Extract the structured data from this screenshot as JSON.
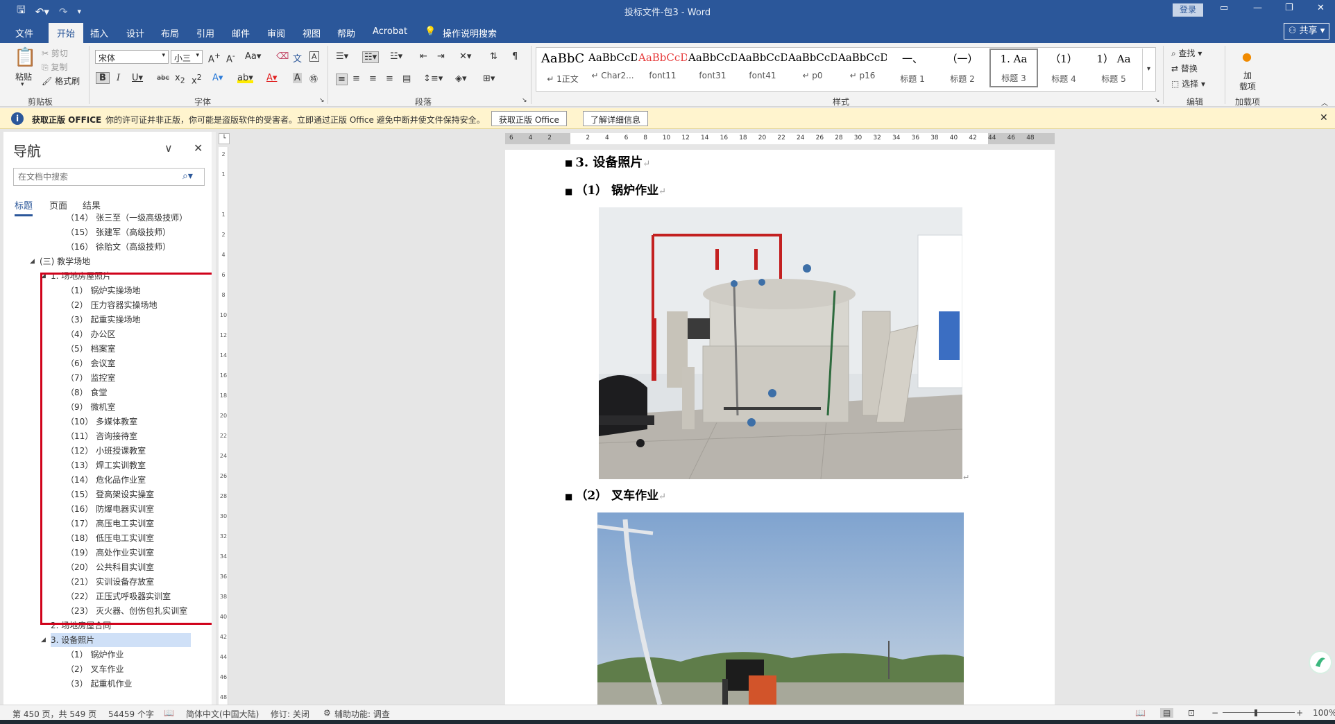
{
  "titlebar": {
    "doc_title": "投标文件-包3 - Word",
    "login": "登录",
    "qat": {
      "save_icon": "save-icon",
      "undo_icon": "undo-icon",
      "redo_icon": "redo-icon",
      "customize_icon": "chevron-down-icon"
    }
  },
  "tabs": [
    "文件",
    "开始",
    "插入",
    "设计",
    "布局",
    "引用",
    "邮件",
    "审阅",
    "视图",
    "帮助",
    "Acrobat"
  ],
  "active_tab": "开始",
  "tell_me": "操作说明搜索",
  "share": "共享",
  "ribbon": {
    "clipboard": {
      "paste": "粘贴",
      "cut": "剪切",
      "copy": "复制",
      "format_painter": "格式刷",
      "label": "剪贴板"
    },
    "font": {
      "font_name": "宋体",
      "font_size": "小三",
      "label": "字体",
      "case": "Aa"
    },
    "paragraph": {
      "label": "段落"
    },
    "styles": {
      "label": "样式",
      "items": [
        {
          "sample": "AaBbC",
          "name": "↵ 1正文",
          "color": "#000000"
        },
        {
          "sample": "AaBbCcDdI",
          "name": "↵ Char2...",
          "color": "#000000"
        },
        {
          "sample": "AaBbCcDdI",
          "name": "font11",
          "color": "#e63b3b"
        },
        {
          "sample": "AaBbCcDc",
          "name": "font31",
          "color": "#000000"
        },
        {
          "sample": "AaBbCcDdI",
          "name": "font41",
          "color": "#000000"
        },
        {
          "sample": "AaBbCcDc",
          "name": "↵ p0",
          "color": "#000000"
        },
        {
          "sample": "AaBbCcDc",
          "name": "↵ p16",
          "color": "#000000"
        },
        {
          "sample": "一、",
          "name": "标题 1",
          "color": "#000000"
        },
        {
          "sample": "（一）",
          "name": "标题 2",
          "color": "#000000"
        },
        {
          "sample": "1.  Aa",
          "name": "标题 3",
          "color": "#000000"
        },
        {
          "sample": "（1） ",
          "name": "标题 4",
          "color": "#000000"
        },
        {
          "sample": "1）  Aa",
          "name": "标题 5",
          "color": "#000000"
        }
      ]
    },
    "editing": {
      "find": "查找",
      "replace": "替换",
      "select": "选择",
      "label": "编辑"
    },
    "addins": {
      "name": "加载项",
      "label": "加载项",
      "short1": "加",
      "short2": "载项"
    }
  },
  "message_bar": {
    "title": "获取正版 OFFICE",
    "text": "你的许可证并非正版，你可能是盗版软件的受害者。立即通过正版 Office 避免中断并使文件保持安全。",
    "button_primary": "获取正版 Office",
    "button_secondary": "了解详细信息"
  },
  "navigation": {
    "title": "导航",
    "search_placeholder": "在文档中搜索",
    "tabs": [
      "标题",
      "页面",
      "结果"
    ],
    "items": [
      {
        "text": "（14） 张三至（一级高级技师）",
        "level": 3
      },
      {
        "text": "（15） 张建军（高级技师）",
        "level": 3
      },
      {
        "text": "（16） 徐贻文（高级技师）",
        "level": 3
      },
      {
        "text": "(三) 教学场地",
        "level": 1,
        "expander": "◢"
      },
      {
        "text": "1. 场地房屋照片",
        "level": 2,
        "expander": "◢"
      },
      {
        "text": "（1） 锅炉实操场地",
        "level": 3
      },
      {
        "text": "（2） 压力容器实操场地",
        "level": 3
      },
      {
        "text": "（3） 起重实操场地",
        "level": 3
      },
      {
        "text": "（4） 办公区",
        "level": 3
      },
      {
        "text": "（5） 档案室",
        "level": 3
      },
      {
        "text": "（6） 会议室",
        "level": 3
      },
      {
        "text": "（7） 监控室",
        "level": 3
      },
      {
        "text": "（8） 食堂",
        "level": 3
      },
      {
        "text": "（9） 微机室",
        "level": 3
      },
      {
        "text": "（10） 多媒体教室",
        "level": 3
      },
      {
        "text": "（11） 咨询接待室",
        "level": 3
      },
      {
        "text": "（12） 小班授课教室",
        "level": 3
      },
      {
        "text": "（13） 焊工实训教室",
        "level": 3
      },
      {
        "text": "（14） 危化品作业室",
        "level": 3
      },
      {
        "text": "（15） 登高架设实操室",
        "level": 3
      },
      {
        "text": "（16） 防爆电器实训室",
        "level": 3
      },
      {
        "text": "（17） 高压电工实训室",
        "level": 3
      },
      {
        "text": "（18） 低压电工实训室",
        "level": 3
      },
      {
        "text": "（19） 高处作业实训室",
        "level": 3
      },
      {
        "text": "（20） 公共科目实训室",
        "level": 3
      },
      {
        "text": "（21） 实训设备存放室",
        "level": 3
      },
      {
        "text": "（22） 正压式呼吸器实训室",
        "level": 3
      },
      {
        "text": "（23） 灭火器、创伤包扎实训室",
        "level": 3
      },
      {
        "text": "2. 场地房屋合同",
        "level": 2
      },
      {
        "text": "3. 设备照片",
        "level": 2,
        "expander": "◢",
        "selected": true
      },
      {
        "text": "（1） 锅炉作业",
        "level": 3
      },
      {
        "text": "（2） 叉车作业",
        "level": 3
      },
      {
        "text": "（3） 起重机作业",
        "level": 3
      }
    ]
  },
  "ruler": {
    "h_numbers": [
      "6",
      "4",
      "2",
      "",
      "2",
      "4",
      "6",
      "8",
      "10",
      "12",
      "14",
      "16",
      "18",
      "20",
      "22",
      "24",
      "26",
      "28",
      "30",
      "32",
      "34",
      "36",
      "38",
      "40",
      "42",
      "44",
      "46",
      "48"
    ],
    "v_numbers": [
      "2",
      "1",
      "",
      "1",
      "2",
      "4",
      "6",
      "8",
      "10",
      "12",
      "14",
      "16",
      "18",
      "20",
      "22",
      "24",
      "26",
      "28",
      "30",
      "32",
      "34",
      "36",
      "38",
      "40",
      "42",
      "44",
      "46",
      "48"
    ]
  },
  "document": {
    "heading_main": "3. 设备照片",
    "heading_sub1": "（1） 锅炉作业",
    "heading_sub2": "（2） 叉车作业",
    "para_mark": "↵"
  },
  "statusbar": {
    "page": "第 450 页，共 549 页",
    "words": "54459 个字",
    "language": "简体中文(中国大陆)",
    "track": "修订: 关闭",
    "accessibility": "辅助功能: 调查",
    "zoom": "100%"
  },
  "colors": {
    "brand": "#2b579a",
    "highlight_box": "#d0021b",
    "message_bar": "#fff4ce"
  }
}
